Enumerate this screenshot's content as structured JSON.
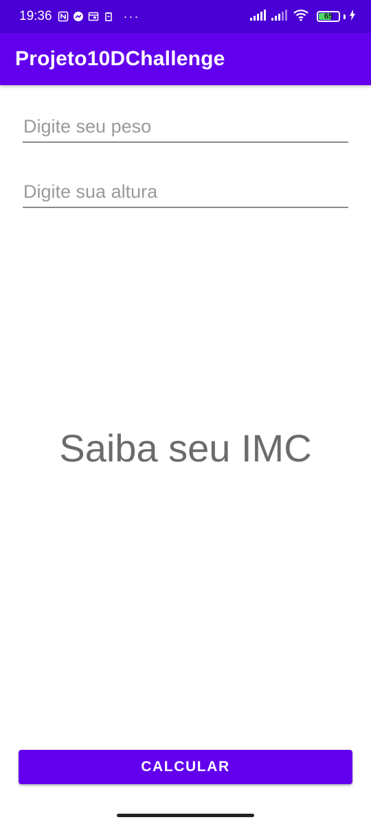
{
  "status_bar": {
    "time": "19:36",
    "notification_icons": [
      "nfc-icon",
      "messenger-icon",
      "calendar-icon",
      "clipboard-icon"
    ],
    "overflow": "···",
    "battery_level": "65",
    "battery_fraction": 0.65,
    "charging": true
  },
  "app_bar": {
    "title": "Projeto10DChallenge",
    "color": "#6200ee"
  },
  "form": {
    "weight_placeholder": "Digite seu peso",
    "weight_value": "",
    "height_placeholder": "Digite sua altura",
    "height_value": ""
  },
  "main": {
    "headline": "Saiba seu IMC"
  },
  "actions": {
    "calculate_label": "CALCULAR"
  }
}
